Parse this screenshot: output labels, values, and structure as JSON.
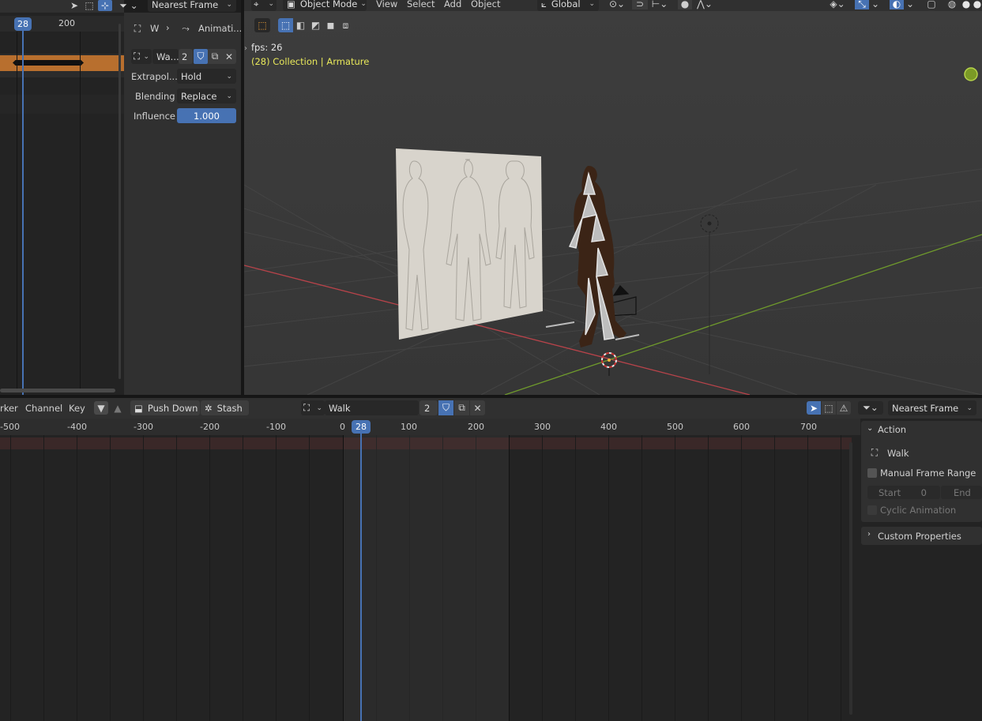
{
  "left_panel": {
    "snap_mode": "Nearest Frame",
    "current_frame": "28",
    "ruler_200": "200",
    "breadcrumb_w": "W",
    "breadcrumb_anim": "Animati...",
    "action_name": "Wa...",
    "action_users": "2",
    "extrapolation_label": "Extrapol...",
    "extrapolation_value": "Hold",
    "blending_label": "Blending",
    "blending_value": "Replace",
    "influence_label": "Influence",
    "influence_value": "1.000"
  },
  "viewport": {
    "mode": "Object Mode",
    "menu_view": "View",
    "menu_select": "Select",
    "menu_add": "Add",
    "menu_object": "Object",
    "orientation": "Global",
    "fps": "fps: 26",
    "object_info": "(28) Collection | Armature"
  },
  "timeline": {
    "menu_marker": "rker",
    "menu_channel": "Channel",
    "menu_key": "Key",
    "push_down": "Push Down",
    "stash": "Stash",
    "action_name": "Walk",
    "action_users": "2",
    "snap_mode": "Nearest Frame",
    "ruler": [
      "-500",
      "-400",
      "-300",
      "-200",
      "-100",
      "0",
      "100",
      "200",
      "300",
      "400",
      "500",
      "600",
      "700"
    ],
    "current_frame": "28"
  },
  "sidebar": {
    "action_header": "Action",
    "action_name": "Walk",
    "manual_frame_range": "Manual Frame Range",
    "start_label": "Start",
    "start_value": "0",
    "end_label": "End",
    "cyclic": "Cyclic Animation",
    "custom_props": "Custom Properties"
  },
  "colors": {
    "accent": "#4772b3",
    "strip_orange": "#c5762f",
    "info_yellow": "#e8e85a",
    "grid_red": "#b8434a",
    "grid_green": "#6f9a2c"
  }
}
